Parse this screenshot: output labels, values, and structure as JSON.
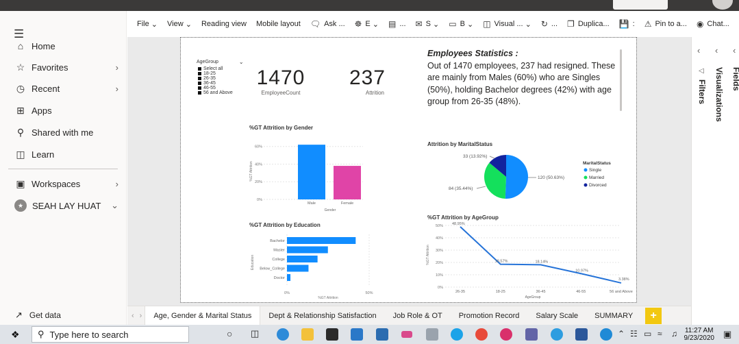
{
  "toolbar": {
    "items": [
      "File",
      "View",
      "Reading view",
      "Mobile layout",
      "Ask ...",
      "E",
      "...",
      "S",
      "B",
      "Visual ...",
      "...",
      "Duplica...",
      "Pin to a...",
      "Chat...",
      "···"
    ]
  },
  "nav": {
    "items": [
      {
        "label": "Home",
        "icon": "home-icon"
      },
      {
        "label": "Favorites",
        "icon": "star-icon"
      },
      {
        "label": "Recent",
        "icon": "clock-icon"
      },
      {
        "label": "Apps",
        "icon": "apps-icon"
      },
      {
        "label": "Shared with me",
        "icon": "shared-icon"
      },
      {
        "label": "Learn",
        "icon": "book-icon"
      }
    ],
    "workspaces": "Workspaces",
    "user": "SEAH LAY HUAT",
    "get_data": "Get data"
  },
  "right_pane": {
    "filters": "Filters",
    "visualizations": "Visualizations",
    "fields": "Fields"
  },
  "slicer": {
    "title": "AgeGroup",
    "options": [
      "Select all",
      "18-25",
      "26-35",
      "36-45",
      "46-55",
      "56 and Above"
    ]
  },
  "kpi": {
    "employee_count": "1470",
    "employee_count_label": "EmployeeCount",
    "attrition": "237",
    "attrition_label": "Attrition"
  },
  "stats": {
    "heading": "Employees Statistics :",
    "body": "Out of 1470 employees, 237 had resigned. These are mainly from Males (60%) who are Singles (50%), holding Bachelor degrees (42%) with age group from 26-35 (48%)."
  },
  "tabs": [
    "Age, Gender & Marital Status",
    "Dept & Relationship Satisfaction",
    "Job Role & OT",
    "Promotion Record",
    "Salary Scale",
    "SUMMARY"
  ],
  "taskbar": {
    "search_placeholder": "Type here to search",
    "time": "11:27 AM",
    "date": "9/23/2020"
  },
  "colors": {
    "blue": "#118dff",
    "pink": "#e044a7",
    "green": "#1aab40",
    "navy": "#12239e",
    "line": "#2573d8",
    "tab_add": "#f2c811"
  },
  "chart_data": [
    {
      "type": "bar",
      "title": "%GT Attrition by Gender",
      "xlabel": "Gender",
      "ylabel": "%GT Attrition",
      "categories": [
        "Male",
        "Female"
      ],
      "values": [
        62,
        38
      ],
      "yticks": [
        "0%",
        "20%",
        "40%",
        "60%"
      ],
      "ylim": [
        0,
        66
      ]
    },
    {
      "type": "pie",
      "title": "Attrition by MaritalStatus",
      "legend_title": "MaritalStatus",
      "categories": [
        "Single",
        "Married",
        "Divorced"
      ],
      "values": [
        120,
        84,
        33
      ],
      "labels": [
        "120 (50.63%)",
        "84 (35.44%)",
        "33 (13.92%)"
      ]
    },
    {
      "type": "bar",
      "orientation": "horizontal",
      "title": "%GT Attrition by Education",
      "xlabel": "%GT Attrition",
      "ylabel": "Education",
      "categories": [
        "Bachelor",
        "Master",
        "College",
        "Below_College",
        "Doctor"
      ],
      "values": [
        41.8,
        24.9,
        18.6,
        13.1,
        2.1
      ],
      "xticks": [
        "0%",
        "50%"
      ],
      "xlim": [
        0,
        50
      ]
    },
    {
      "type": "line",
      "title": "%GT Attrition by AgeGroup",
      "xlabel": "AgeGroup",
      "ylabel": "%GT Attrition",
      "categories": [
        "26-35",
        "18-25",
        "36-45",
        "46-55",
        "56 and Above"
      ],
      "values": [
        48.95,
        18.57,
        18.14,
        10.97,
        3.38
      ],
      "labels": [
        "48.95%",
        "18.57%",
        "18.14%",
        "10.97%",
        "3.38%"
      ],
      "yticks": [
        "0%",
        "10%",
        "20%",
        "30%",
        "40%",
        "50%"
      ],
      "ylim": [
        0,
        50
      ]
    }
  ]
}
